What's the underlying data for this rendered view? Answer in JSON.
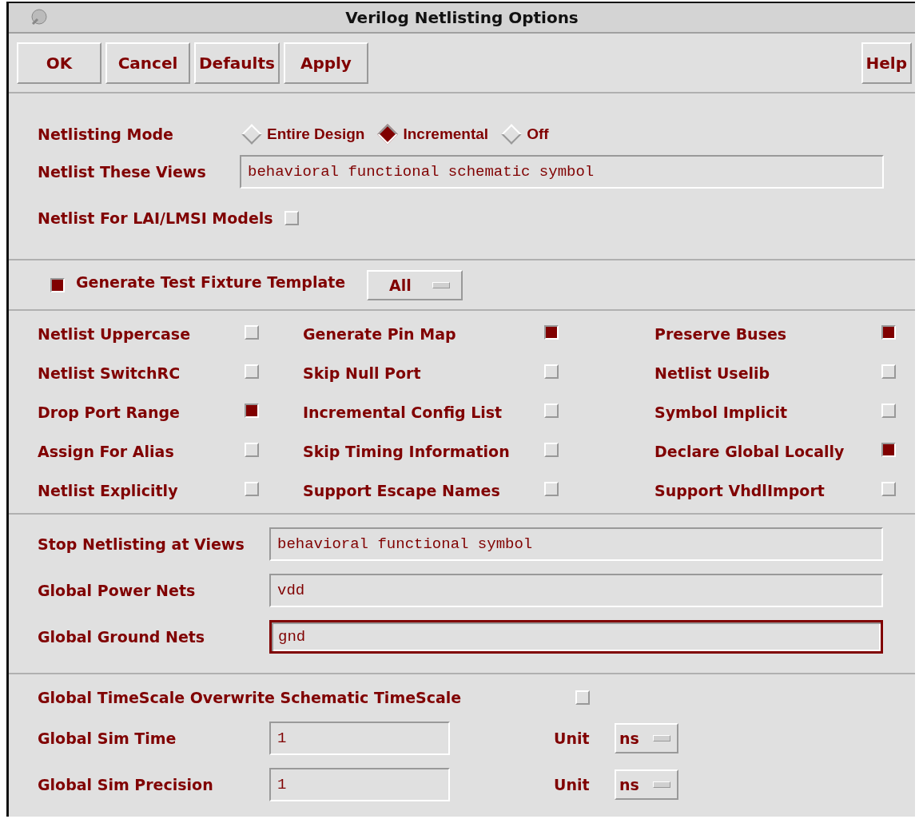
{
  "window": {
    "title": "Verilog Netlisting Options"
  },
  "buttons": [
    {
      "label": "OK"
    },
    {
      "label": "Cancel"
    },
    {
      "label": "Defaults"
    },
    {
      "label": "Apply"
    }
  ],
  "help_button": {
    "label": "Help"
  },
  "netlisting_mode": {
    "label": "Netlisting Mode",
    "options": [
      {
        "label": "Entire Design",
        "selected": false
      },
      {
        "label": "Incremental",
        "selected": true
      },
      {
        "label": "Off",
        "selected": false
      }
    ]
  },
  "netlist_these_views": {
    "label": "Netlist These Views",
    "value": "behavioral functional schematic symbol"
  },
  "lai_lmsi": {
    "label": "Netlist For LAI/LMSI Models",
    "checked": false
  },
  "test_fixture": {
    "label": "Generate Test Fixture Template",
    "checked": true,
    "dropdown": "All"
  },
  "options": [
    {
      "label": "Netlist Uppercase",
      "checked": false
    },
    {
      "label": "Generate Pin Map",
      "checked": true
    },
    {
      "label": "Preserve Buses",
      "checked": true
    },
    {
      "label": "Netlist SwitchRC",
      "checked": false
    },
    {
      "label": "Skip Null Port",
      "checked": false
    },
    {
      "label": "Netlist Uselib",
      "checked": false
    },
    {
      "label": "Drop Port Range",
      "checked": true
    },
    {
      "label": "Incremental Config List",
      "checked": false
    },
    {
      "label": "Symbol Implicit",
      "checked": false
    },
    {
      "label": "Assign For Alias",
      "checked": false
    },
    {
      "label": "Skip Timing Information",
      "checked": false
    },
    {
      "label": "Declare Global Locally",
      "checked": true
    },
    {
      "label": "Netlist Explicitly",
      "checked": false
    },
    {
      "label": "Support Escape Names",
      "checked": false
    },
    {
      "label": "Support VhdlImport",
      "checked": false
    }
  ],
  "net_fields": [
    {
      "label": "Stop Netlisting at Views",
      "value": "behavioral functional symbol",
      "focused": false
    },
    {
      "label": "Global Power Nets",
      "value": "vdd",
      "focused": false
    },
    {
      "label": "Global Ground Nets",
      "value": "gnd",
      "focused": true
    }
  ],
  "timescale_overwrite": {
    "label": "Global TimeScale Overwrite Schematic TimeScale",
    "checked": false
  },
  "sim_settings": [
    {
      "label": "Global Sim Time",
      "value": "1",
      "unit_label": "Unit",
      "unit": "ns"
    },
    {
      "label": "Global Sim Precision",
      "value": "1",
      "unit_label": "Unit",
      "unit": "ns"
    }
  ]
}
